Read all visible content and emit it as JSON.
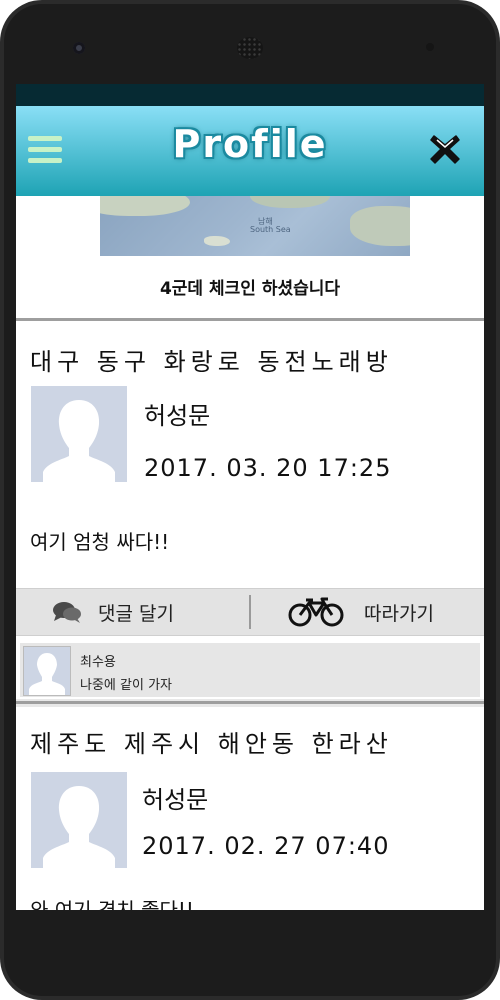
{
  "app": {
    "title": "Profile"
  },
  "map": {
    "label_ko": "남해",
    "label_en": "South Sea"
  },
  "checkin_text": "4군데 체크인 하셨습니다",
  "posts": [
    {
      "location": "대구 동구 화랑로 동전노래방",
      "author": "허성문",
      "datetime": "2017. 03. 20 17:25",
      "body": "여기 엄청 싸다!!",
      "actions": {
        "comment_label": "댓글 달기",
        "follow_label": "따라가기"
      },
      "comments": [
        {
          "name": "최수용",
          "text": "나중에 같이 가자"
        }
      ]
    },
    {
      "location": "제주도 제주시 해안동 한라산",
      "author": "허성문",
      "datetime": "2017. 02. 27 07:40",
      "body": "와 여기 경치 좋다!!"
    }
  ],
  "colors": {
    "app_bar_top": "#8adff6",
    "app_bar_bottom": "#1ea3b4",
    "status_bar": "#062a33",
    "avatar_bg": "#cdd5e4"
  },
  "icons": {
    "menu": "hamburger-icon",
    "close": "close-icon",
    "comment": "speech-bubbles-icon",
    "follow": "bicycle-icon"
  }
}
